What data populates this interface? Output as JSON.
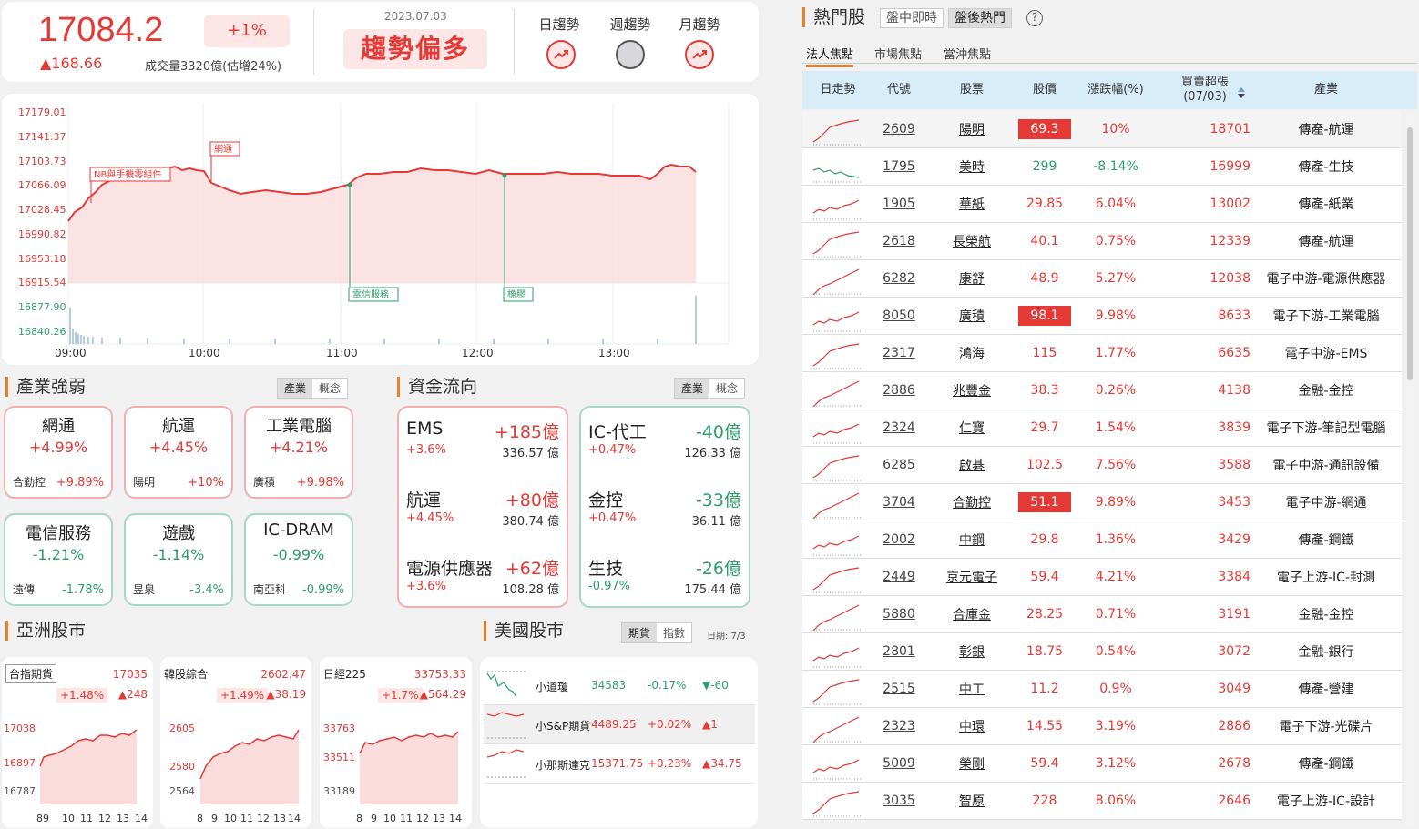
{
  "index": {
    "price": "17084.2",
    "change": "▲168.66",
    "pct": "+1%",
    "volume": "成交量3320億(估增24%)",
    "date": "2023.07.03",
    "trend": "趨勢偏多",
    "trends": [
      {
        "label": "日趨勢",
        "state": "up"
      },
      {
        "label": "週趨勢",
        "state": "flat"
      },
      {
        "label": "月趨勢",
        "state": "up"
      }
    ]
  },
  "main_chart": {
    "y_ticks": [
      "17179.01",
      "17141.37",
      "17103.73",
      "17066.09",
      "17028.45",
      "16990.82",
      "16953.18",
      "16915.54"
    ],
    "vol_ticks": [
      "16877.90",
      "16840.26"
    ],
    "x_ticks": [
      "09:00",
      "10:00",
      "11:00",
      "12:00",
      "13:00"
    ],
    "annotations": [
      "NB與手機零組件",
      "網通",
      "電信服務",
      "橡膠"
    ]
  },
  "industry": {
    "title": "產業強弱",
    "toggle": [
      "產業",
      "概念"
    ],
    "items": [
      {
        "name": "網通",
        "pct": "+4.99%",
        "stock": "合勤控",
        "stock_pct": "+9.89%",
        "dir": "up"
      },
      {
        "name": "航運",
        "pct": "+4.45%",
        "stock": "陽明",
        "stock_pct": "+10%",
        "dir": "up"
      },
      {
        "name": "工業電腦",
        "pct": "+4.21%",
        "stock": "廣積",
        "stock_pct": "+9.98%",
        "dir": "up"
      },
      {
        "name": "電信服務",
        "pct": "-1.21%",
        "stock": "遠傳",
        "stock_pct": "-1.78%",
        "dir": "dn"
      },
      {
        "name": "遊戲",
        "pct": "-1.14%",
        "stock": "昱泉",
        "stock_pct": "-3.4%",
        "dir": "dn"
      },
      {
        "name": "IC-DRAM",
        "pct": "-0.99%",
        "stock": "南亞科",
        "stock_pct": "-0.99%",
        "dir": "dn"
      }
    ]
  },
  "flow": {
    "title": "資金流向",
    "toggle": [
      "產業",
      "概念"
    ],
    "inflow": [
      {
        "name": "EMS",
        "amount": "+185億",
        "pct": "+3.6%",
        "value": "336.57 億"
      },
      {
        "name": "航運",
        "amount": "+80億",
        "pct": "+4.45%",
        "value": "380.74 億"
      },
      {
        "name": "電源供應器",
        "amount": "+62億",
        "pct": "+3.6%",
        "value": "108.28 億"
      }
    ],
    "outflow": [
      {
        "name": "IC-代工",
        "amount": "-40億",
        "pct": "+0.47%",
        "value": "126.33 億"
      },
      {
        "name": "金控",
        "amount": "-33億",
        "pct": "+0.47%",
        "value": "36.11 億"
      },
      {
        "name": "生技",
        "amount": "-26億",
        "pct": "-0.97%",
        "value": "175.44 億"
      }
    ]
  },
  "asia": {
    "title": "亞洲股市",
    "markets": [
      {
        "name": "台指期貨",
        "price": "17035",
        "pct": "+1.48%",
        "chg": "▲248",
        "ticks": [
          "17038",
          "16897",
          "16787"
        ],
        "x": [
          "89",
          "10",
          "11",
          "12",
          "13",
          "14"
        ]
      },
      {
        "name": "韓股綜合",
        "price": "2602.47",
        "pct": "+1.49%",
        "chg": "▲38.19",
        "ticks": [
          "2605",
          "2580",
          "2564"
        ],
        "x": [
          "8",
          "9",
          "10",
          "11",
          "12",
          "13",
          "14"
        ]
      },
      {
        "name": "日經225",
        "price": "33753.33",
        "pct": "+1.7%",
        "chg": "▲564.29",
        "ticks": [
          "33763",
          "33511",
          "33189"
        ],
        "x": [
          "8",
          "9",
          "10",
          "11",
          "12",
          "13",
          "14"
        ]
      }
    ]
  },
  "us": {
    "title": "美國股市",
    "toggle": [
      "期貨",
      "指數"
    ],
    "date": "日期: 7/3",
    "rows": [
      {
        "name": "小道瓊",
        "price": "34583",
        "pct": "-0.17%",
        "chg": "▼-60",
        "dir": "dn"
      },
      {
        "name": "小S&P期貨",
        "price": "4489.25",
        "pct": "+0.02%",
        "chg": "▲1",
        "dir": "up"
      },
      {
        "name": "小那斯達克",
        "price": "15371.75",
        "pct": "+0.23%",
        "chg": "▲34.75",
        "dir": "up"
      }
    ]
  },
  "hot": {
    "title": "熱門股",
    "tabs": [
      "盤中即時",
      "盤後熱門"
    ],
    "help": "?",
    "subtabs": [
      "法人焦點",
      "市場焦點",
      "當沖焦點"
    ],
    "headers": [
      "日走勢",
      "代號",
      "股票",
      "股價",
      "漲跌幅(%)",
      "買賣超張",
      "(07/03)",
      "產業"
    ],
    "sort_icon": "sort-icon",
    "rows": [
      {
        "code": "2609",
        "name": "陽明",
        "price": "69.3",
        "pct": "10%",
        "vol": "18701",
        "ind": "傳產-航運",
        "dir": "up",
        "limit": true
      },
      {
        "code": "1795",
        "name": "美時",
        "price": "299",
        "pct": "-8.14%",
        "vol": "16999",
        "ind": "傳產-生技",
        "dir": "dn",
        "limit": false
      },
      {
        "code": "1905",
        "name": "華紙",
        "price": "29.85",
        "pct": "6.04%",
        "vol": "13002",
        "ind": "傳產-紙業",
        "dir": "up",
        "limit": false
      },
      {
        "code": "2618",
        "name": "長榮航",
        "price": "40.1",
        "pct": "0.75%",
        "vol": "12339",
        "ind": "傳產-航運",
        "dir": "up",
        "limit": false
      },
      {
        "code": "6282",
        "name": "康舒",
        "price": "48.9",
        "pct": "5.27%",
        "vol": "12038",
        "ind": "電子中游-電源供應器",
        "dir": "up",
        "limit": false
      },
      {
        "code": "8050",
        "name": "廣積",
        "price": "98.1",
        "pct": "9.98%",
        "vol": "8633",
        "ind": "電子下游-工業電腦",
        "dir": "up",
        "limit": true
      },
      {
        "code": "2317",
        "name": "鴻海",
        "price": "115",
        "pct": "1.77%",
        "vol": "6635",
        "ind": "電子中游-EMS",
        "dir": "up",
        "limit": false
      },
      {
        "code": "2886",
        "name": "兆豐金",
        "price": "38.3",
        "pct": "0.26%",
        "vol": "4138",
        "ind": "金融-金控",
        "dir": "up",
        "limit": false
      },
      {
        "code": "2324",
        "name": "仁寶",
        "price": "29.7",
        "pct": "1.54%",
        "vol": "3839",
        "ind": "電子下游-筆記型電腦",
        "dir": "up",
        "limit": false
      },
      {
        "code": "6285",
        "name": "啟碁",
        "price": "102.5",
        "pct": "7.56%",
        "vol": "3588",
        "ind": "電子中游-通訊設備",
        "dir": "up",
        "limit": false
      },
      {
        "code": "3704",
        "name": "合勤控",
        "price": "51.1",
        "pct": "9.89%",
        "vol": "3453",
        "ind": "電子中游-網通",
        "dir": "up",
        "limit": true
      },
      {
        "code": "2002",
        "name": "中鋼",
        "price": "29.8",
        "pct": "1.36%",
        "vol": "3429",
        "ind": "傳產-鋼鐵",
        "dir": "up",
        "limit": false
      },
      {
        "code": "2449",
        "name": "京元電子",
        "price": "59.4",
        "pct": "4.21%",
        "vol": "3384",
        "ind": "電子上游-IC-封測",
        "dir": "up",
        "limit": false
      },
      {
        "code": "5880",
        "name": "合庫金",
        "price": "28.25",
        "pct": "0.71%",
        "vol": "3191",
        "ind": "金融-金控",
        "dir": "up",
        "limit": false
      },
      {
        "code": "2801",
        "name": "彰銀",
        "price": "18.75",
        "pct": "0.54%",
        "vol": "3072",
        "ind": "金融-銀行",
        "dir": "up",
        "limit": false
      },
      {
        "code": "2515",
        "name": "中工",
        "price": "11.2",
        "pct": "0.9%",
        "vol": "3049",
        "ind": "傳產-營建",
        "dir": "up",
        "limit": false
      },
      {
        "code": "2323",
        "name": "中環",
        "price": "14.55",
        "pct": "3.19%",
        "vol": "2886",
        "ind": "電子下游-光碟片",
        "dir": "up",
        "limit": false
      },
      {
        "code": "5009",
        "name": "榮剛",
        "price": "59.4",
        "pct": "3.12%",
        "vol": "2678",
        "ind": "傳產-鋼鐵",
        "dir": "up",
        "limit": false
      },
      {
        "code": "3035",
        "name": "智原",
        "price": "228",
        "pct": "8.06%",
        "vol": "2646",
        "ind": "電子上游-IC-設計",
        "dir": "up",
        "limit": false
      }
    ]
  },
  "colors": {
    "up": "#e53935",
    "down": "#2e9e6b",
    "accent": "#e8812a",
    "header_bg": "#d9edf9"
  }
}
